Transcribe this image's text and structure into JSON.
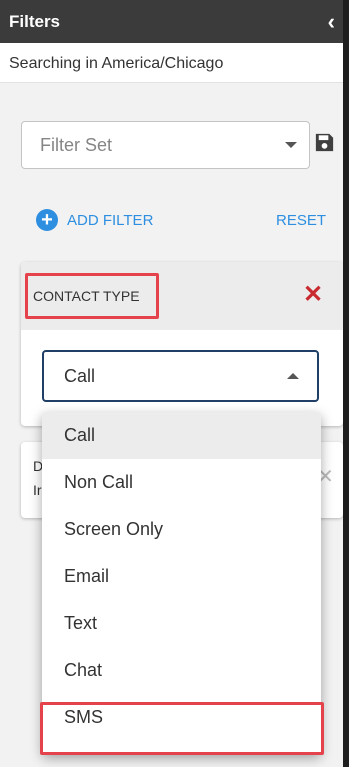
{
  "header": {
    "title": "Filters",
    "collapse_icon": "‹"
  },
  "searching_text": "Searching in America/Chicago",
  "filter_set": {
    "placeholder": "Filter Set"
  },
  "actions": {
    "add_filter": "ADD FILTER",
    "reset": "RESET"
  },
  "contact_type_filter": {
    "label": "CONTACT TYPE",
    "remove": "✕",
    "selected_value": "Call"
  },
  "second_filter": {
    "line1": "D",
    "line2": "Ir"
  },
  "dropdown": {
    "options": [
      "Call",
      "Non Call",
      "Screen Only",
      "Email",
      "Text",
      "Chat",
      "SMS"
    ],
    "highlighted": "Call",
    "annotated": "SMS"
  },
  "colors": {
    "header_bg": "#3b3b3b",
    "accent_blue": "#2e8fe0",
    "remove_red": "#c92a2f",
    "annotation_red": "#e5434b",
    "select_border": "#1f3f66"
  },
  "icons": [
    "chevron-left-icon",
    "caret-down-icon",
    "save-icon",
    "plus-circle-icon",
    "close-icon",
    "caret-up-icon"
  ]
}
